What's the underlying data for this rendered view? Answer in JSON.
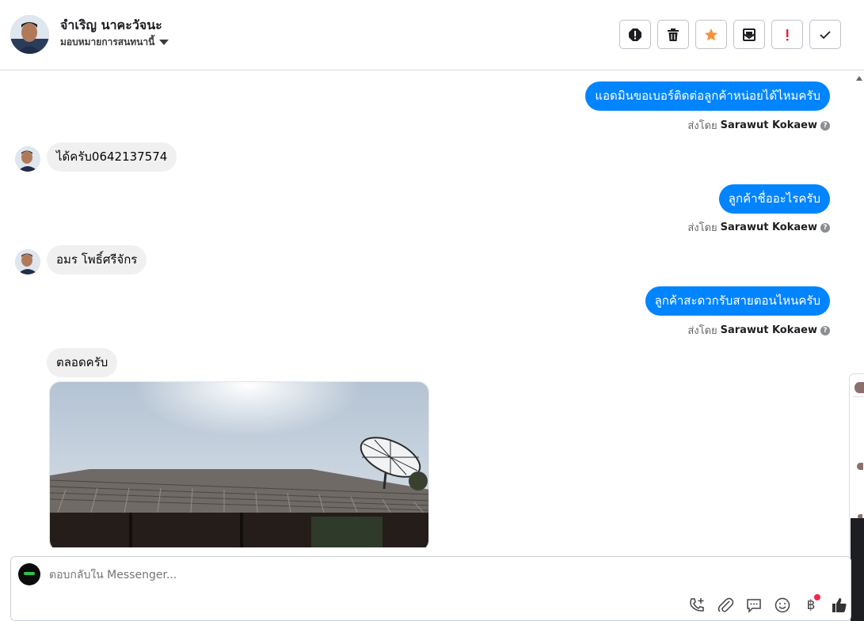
{
  "header": {
    "contact_name": "จำเริญ นาคะวัจนะ",
    "assign_label": "มอบหมายการสนทนานี้",
    "actions": [
      {
        "name": "report-spam",
        "icon": "alert-icon"
      },
      {
        "name": "delete",
        "icon": "trash-icon"
      },
      {
        "name": "star",
        "icon": "star-icon",
        "color": "#f7923a"
      },
      {
        "name": "mark-unread",
        "icon": "envelope-icon"
      },
      {
        "name": "follow-up",
        "icon": "exclamation-icon",
        "color": "#e41e3f"
      },
      {
        "name": "mark-done",
        "icon": "check-icon"
      }
    ]
  },
  "messages": [
    {
      "direction": "out",
      "text": "แอดมินขอเบอร์ติดต่อลูกค้าหน่อยได้ไหมครับ",
      "sent_by_label": "ส่งโดย",
      "sender": "Sarawut Kokaew"
    },
    {
      "direction": "in",
      "text": "ได้ครับ0642137574"
    },
    {
      "direction": "out",
      "text": "ลูกค้าชื่ออะไรครับ",
      "sent_by_label": "ส่งโดย",
      "sender": "Sarawut Kokaew"
    },
    {
      "direction": "in",
      "text": "อมร โพธิ์ศรีจักร"
    },
    {
      "direction": "out",
      "text": "ลูกค้าสะดวกรับสายตอนไหนครับ",
      "sent_by_label": "ส่งโดย",
      "sender": "Sarawut Kokaew"
    },
    {
      "direction": "in",
      "text": "ตลอดครับ"
    }
  ],
  "composer": {
    "placeholder": "ตอบกลับใน Messenger...",
    "tools": [
      "phone-add-icon",
      "paperclip-icon",
      "chat-bubble-icon",
      "smiley-icon",
      "baht-icon",
      "thumbs-up-icon"
    ],
    "baht_symbol": "฿"
  },
  "colors": {
    "outgoing_bubble": "#0084ff",
    "incoming_bubble": "#f0f0f0",
    "star": "#f7923a",
    "alert": "#e41e3f"
  }
}
